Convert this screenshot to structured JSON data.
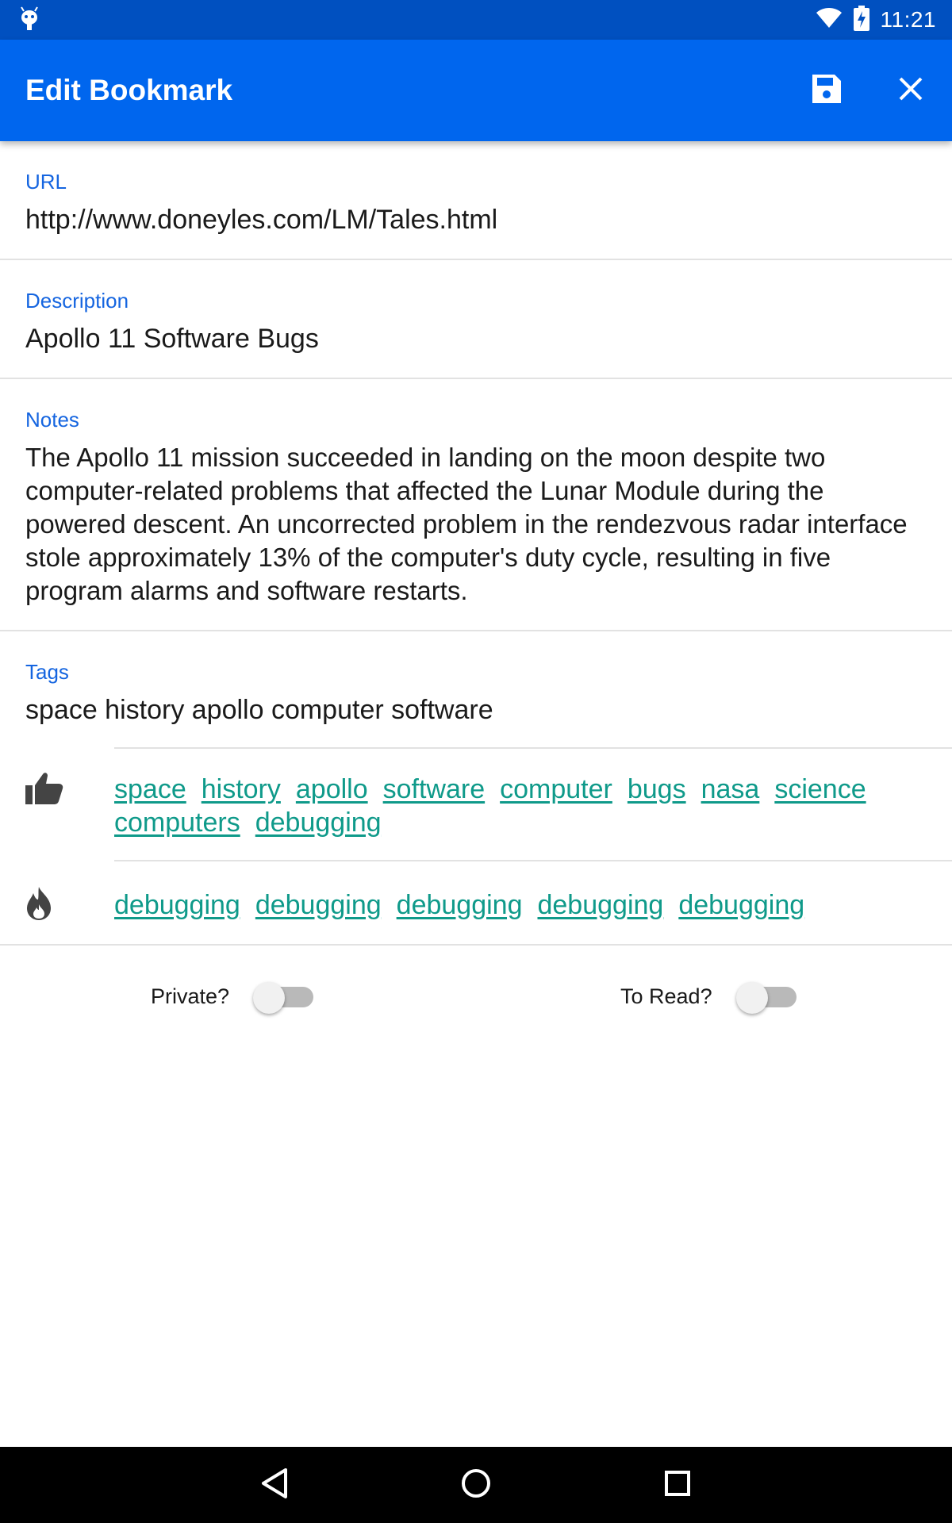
{
  "status_bar": {
    "time": "11:21",
    "icons": [
      "android-debug-icon",
      "wifi-icon",
      "battery-charging-icon"
    ]
  },
  "app_bar": {
    "title": "Edit Bookmark",
    "actions": [
      "save-icon",
      "close-icon"
    ]
  },
  "form": {
    "url": {
      "label": "URL",
      "value": "http://www.doneyles.com/LM/Tales.html"
    },
    "description": {
      "label": "Description",
      "value": "Apollo 11 Software Bugs"
    },
    "notes": {
      "label": "Notes",
      "value": "The Apollo 11 mission succeeded in landing on the moon despite two computer-related problems that affected the Lunar Module during the powered descent. An uncorrected problem in the rendezvous radar interface stole approximately 13% of the computer's duty cycle, resulting in five program alarms and software restarts."
    },
    "tags": {
      "label": "Tags",
      "value": "space history apollo computer software"
    }
  },
  "suggested_tags": {
    "icon": "thumbs-up-icon",
    "items": [
      "space",
      "history",
      "apollo",
      "software",
      "computer",
      "bugs",
      "nasa",
      "science",
      "computers",
      "debugging"
    ]
  },
  "popular_tags": {
    "icon": "flame-icon",
    "items": [
      "debugging",
      "debugging",
      "debugging",
      "debugging",
      "debugging"
    ]
  },
  "toggles": {
    "private": {
      "label": "Private?",
      "checked": false
    },
    "to_read": {
      "label": "To Read?",
      "checked": false
    }
  },
  "colors": {
    "status_bar": "#0050c0",
    "app_bar": "#0066ee",
    "label": "#1565e0",
    "tag_link": "#0f9a8a"
  },
  "nav_bar": {
    "buttons": [
      "back-icon",
      "home-icon",
      "recents-icon"
    ]
  }
}
